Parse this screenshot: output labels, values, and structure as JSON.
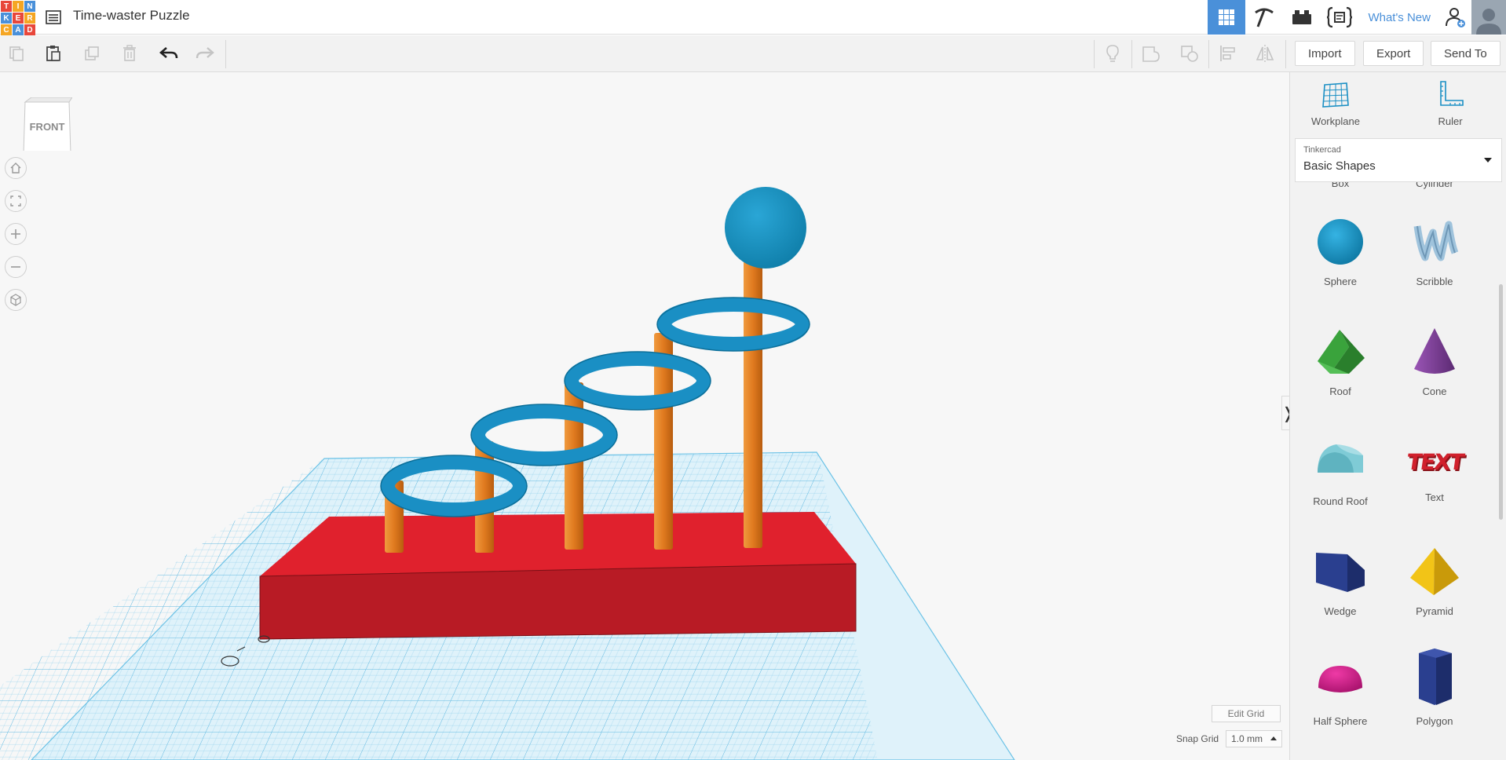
{
  "app": {
    "title": "Time-waster Puzzle",
    "logo_letters": [
      "T",
      "I",
      "N",
      "K",
      "E",
      "R",
      "C",
      "A",
      "D"
    ],
    "logo_colors": [
      "#e8473b",
      "#f5a623",
      "#4a90d9",
      "#4a90d9",
      "#e8473b",
      "#f5a623",
      "#f5a623",
      "#4a90d9",
      "#e8473b"
    ]
  },
  "topnav": {
    "whats_new": "What's New"
  },
  "toolbar": {
    "import_label": "Import",
    "export_label": "Export",
    "send_to_label": "Send To"
  },
  "viewcube": {
    "face_label": "FRONT"
  },
  "canvas": {
    "edit_grid_label": "Edit Grid",
    "snap_grid_label": "Snap Grid",
    "snap_grid_value": "1.0 mm",
    "collapse_glyph": "❭"
  },
  "panel": {
    "workplane_label": "Workplane",
    "ruler_label": "Ruler",
    "library_small": "Tinkercad",
    "library_selected": "Basic Shapes",
    "partial_labels": [
      "Box",
      "Cylinder"
    ],
    "shapes": [
      {
        "label": "Sphere",
        "icon": "sphere-icon"
      },
      {
        "label": "Scribble",
        "icon": "scribble-icon"
      },
      {
        "label": "Roof",
        "icon": "roof-icon"
      },
      {
        "label": "Cone",
        "icon": "cone-icon"
      },
      {
        "label": "Round Roof",
        "icon": "round-roof-icon"
      },
      {
        "label": "Text",
        "icon": "text-icon"
      },
      {
        "label": "Wedge",
        "icon": "wedge-icon"
      },
      {
        "label": "Pyramid",
        "icon": "pyramid-icon"
      },
      {
        "label": "Half Sphere",
        "icon": "half-sphere-icon"
      },
      {
        "label": "Polygon",
        "icon": "polygon-icon"
      }
    ],
    "text_shape_glyph": "TEXT"
  },
  "colors": {
    "accent": "#4a90d9",
    "base_red": "#d91f2b",
    "post_orange": "#e07a1f",
    "ring_blue": "#1a8fc4",
    "grid_blue": "#bfe6f5"
  }
}
